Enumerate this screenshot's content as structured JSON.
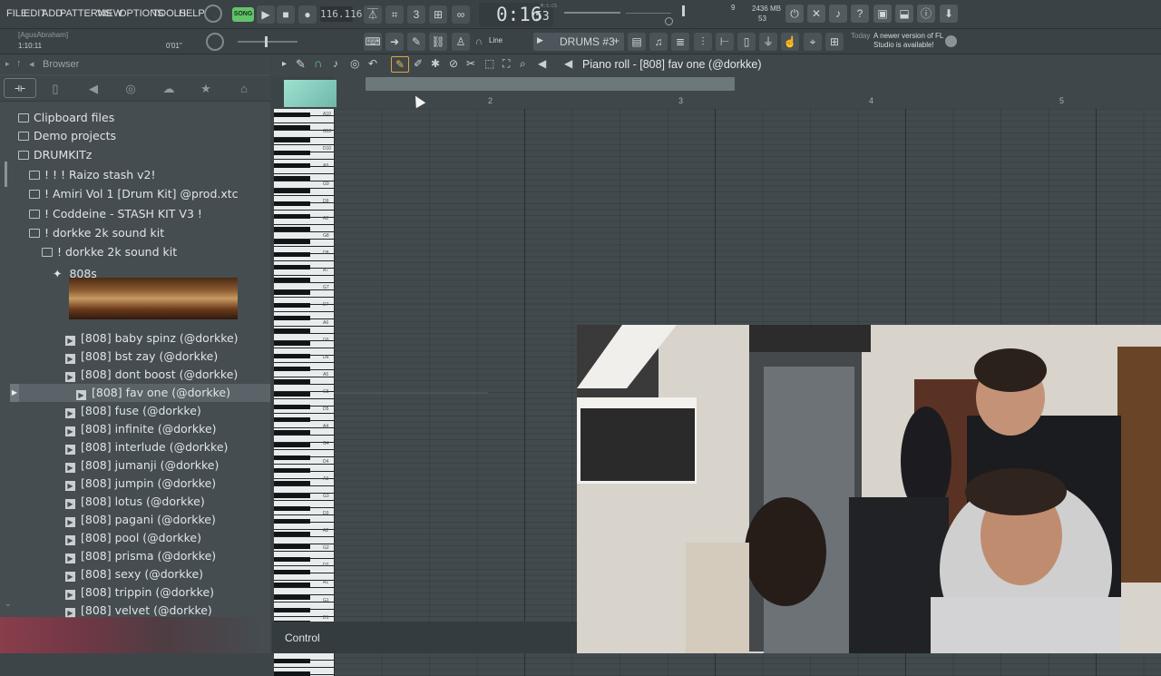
{
  "menu": [
    "FILE",
    "EDIT",
    "ADD",
    "PATTERNS",
    "VIEW",
    "OPTIONS",
    "TOOLS",
    "HELP"
  ],
  "transport": {
    "song_label": "SONG",
    "tempo": "116.116",
    "time": "0:16",
    "time_sub": "53",
    "time_unit": "M:S:CS",
    "cpu_mem": "2436 MB",
    "polyphony": "53",
    "meter_num": "9"
  },
  "hint": {
    "user": "[AgusAbraham]",
    "time": "1:10:11",
    "duration": "0'01\""
  },
  "toolbar": {
    "snap_mode": "Line",
    "pattern": "DRUMS #3",
    "news_today": "Today",
    "news_text": "A newer version of FL Studio is available!"
  },
  "browser": {
    "title": "Browser",
    "items": [
      {
        "label": "Clipboard files",
        "type": "folder",
        "indent": 0
      },
      {
        "label": "Demo projects",
        "type": "folder",
        "indent": 0
      },
      {
        "label": "DRUMKITz",
        "type": "folder",
        "indent": 0
      },
      {
        "label": "! ! ! Raizo stash v2!",
        "type": "folder",
        "indent": 1
      },
      {
        "label": "! Amiri Vol 1 [Drum Kit] @prod.xtc",
        "type": "folder",
        "indent": 1
      },
      {
        "label": "! Coddeine - STASH KIT V3 !",
        "type": "folder",
        "indent": 1
      },
      {
        "label": "! dorkke 2k sound kit",
        "type": "folder",
        "indent": 1
      },
      {
        "label": "! dorkke 2k sound kit",
        "type": "folder",
        "indent": 2
      },
      {
        "label": "808s",
        "type": "folder-open",
        "indent": 3
      },
      {
        "label": "[808] baby spinz (@dorkke)",
        "type": "file",
        "indent": 4
      },
      {
        "label": "[808] bst zay (@dorkke)",
        "type": "file",
        "indent": 4
      },
      {
        "label": "[808] dont boost (@dorkke)",
        "type": "file",
        "indent": 4
      },
      {
        "label": "[808] fav one (@dorkke)",
        "type": "file",
        "indent": 4,
        "selected": true
      },
      {
        "label": "[808] fuse (@dorkke)",
        "type": "file",
        "indent": 4
      },
      {
        "label": "[808] infinite (@dorkke)",
        "type": "file",
        "indent": 4
      },
      {
        "label": "[808] interlude (@dorkke)",
        "type": "file",
        "indent": 4
      },
      {
        "label": "[808] jumanji (@dorkke)",
        "type": "file",
        "indent": 4
      },
      {
        "label": "[808] jumpin (@dorkke)",
        "type": "file",
        "indent": 4
      },
      {
        "label": "[808] lotus (@dorkke)",
        "type": "file",
        "indent": 4
      },
      {
        "label": "[808] pagani (@dorkke)",
        "type": "file",
        "indent": 4
      },
      {
        "label": "[808] pool (@dorkke)",
        "type": "file",
        "indent": 4
      },
      {
        "label": "[808] prisma (@dorkke)",
        "type": "file",
        "indent": 4
      },
      {
        "label": "[808] sexy (@dorkke)",
        "type": "file",
        "indent": 4
      },
      {
        "label": "[808] trippin (@dorkke)",
        "type": "file",
        "indent": 4
      },
      {
        "label": "[808] velvet (@dorkke)",
        "type": "file",
        "indent": 4
      }
    ]
  },
  "piano_roll": {
    "title": "Piano roll - [808] fav one (@dorkke)",
    "bars": [
      "2",
      "3",
      "4",
      "5"
    ],
    "key_labels": [
      "A10",
      "G10",
      "D10",
      "A9",
      "G9",
      "D9",
      "A8",
      "G8",
      "D8",
      "A7",
      "G7",
      "D7",
      "A6",
      "G6",
      "D6",
      "A5",
      "G5",
      "D5",
      "A4",
      "G4",
      "D4",
      "A3",
      "G3",
      "D3",
      "A2",
      "G2",
      "D2",
      "A1",
      "G1",
      "D1",
      "A0",
      "G0"
    ],
    "control_label": "Control"
  }
}
